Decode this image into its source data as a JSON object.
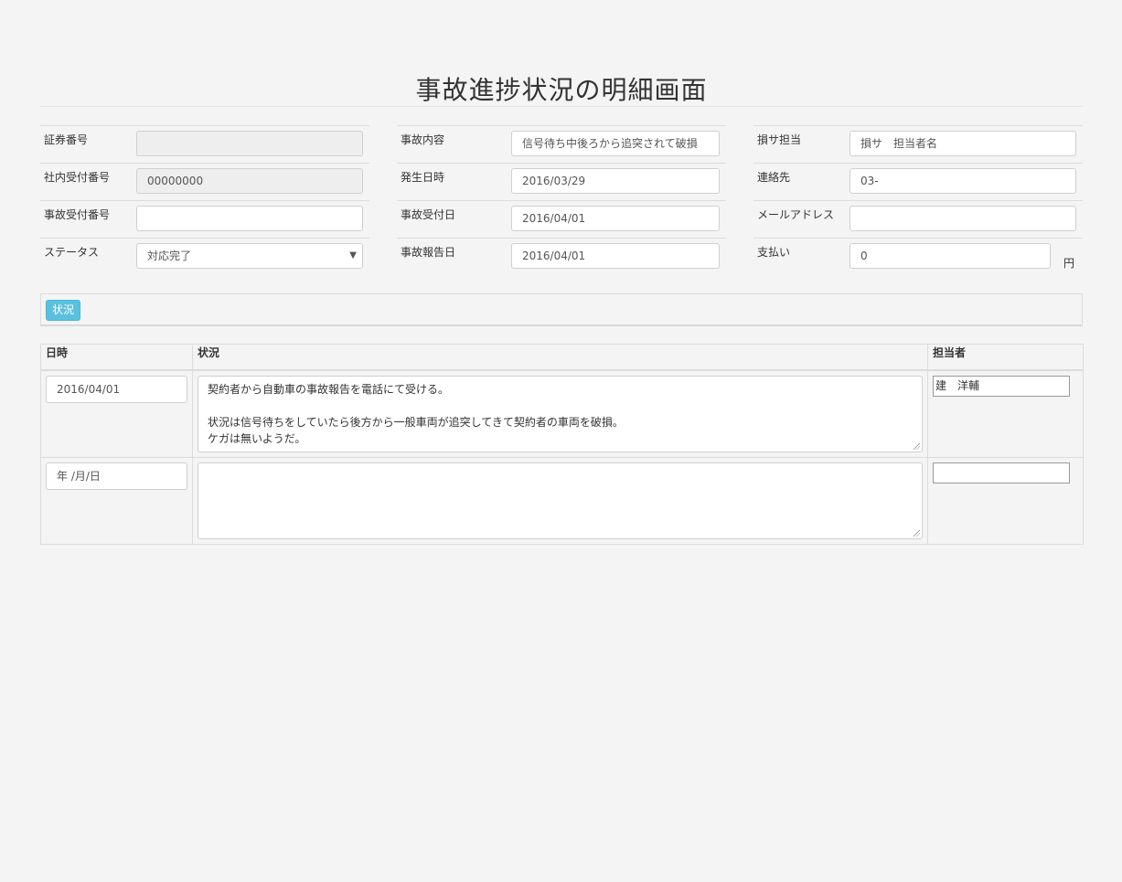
{
  "page": {
    "title": "事故進捗状況の明細画面"
  },
  "form": {
    "col1": [
      {
        "label": "証券番号",
        "value": ""
      },
      {
        "label": "社内受付番号",
        "value": "00000000"
      },
      {
        "label": "事故受付番号",
        "value": ""
      },
      {
        "label": "ステータス",
        "value": "対応完了"
      }
    ],
    "col2": [
      {
        "label": "事故内容",
        "value": "信号待ち中後ろから追突されて破損"
      },
      {
        "label": "発生日時",
        "value": "2016/03/29"
      },
      {
        "label": "事故受付日",
        "value": "2016/04/01"
      },
      {
        "label": "事故報告日",
        "value": "2016/04/01"
      }
    ],
    "col3": [
      {
        "label": "損サ担当",
        "value": "損サ　担当者名"
      },
      {
        "label": "連絡先",
        "value": "03-"
      },
      {
        "label": "メールアドレス",
        "value": ""
      },
      {
        "label": "支払い",
        "value": "0",
        "unit": "円"
      }
    ]
  },
  "tabs": [
    {
      "label": "状況",
      "active": true
    }
  ],
  "table": {
    "headers": [
      "日時",
      "状況",
      "担当者"
    ],
    "rows": [
      {
        "date": "2016/04/01",
        "status": "契約者から自動車の事故報告を電話にて受ける。\n\n状況は信号待ちをしていたら後方から一般車両が追突してきて契約者の車両を破損。\nケガは無いようだ。",
        "staff": "建　洋輔"
      },
      {
        "date": "年 /月/日",
        "status": "",
        "staff": ""
      }
    ]
  },
  "colors": {
    "accent": "#5bc0de",
    "background": "#f4f4f4",
    "border": "#dcdcdc"
  }
}
